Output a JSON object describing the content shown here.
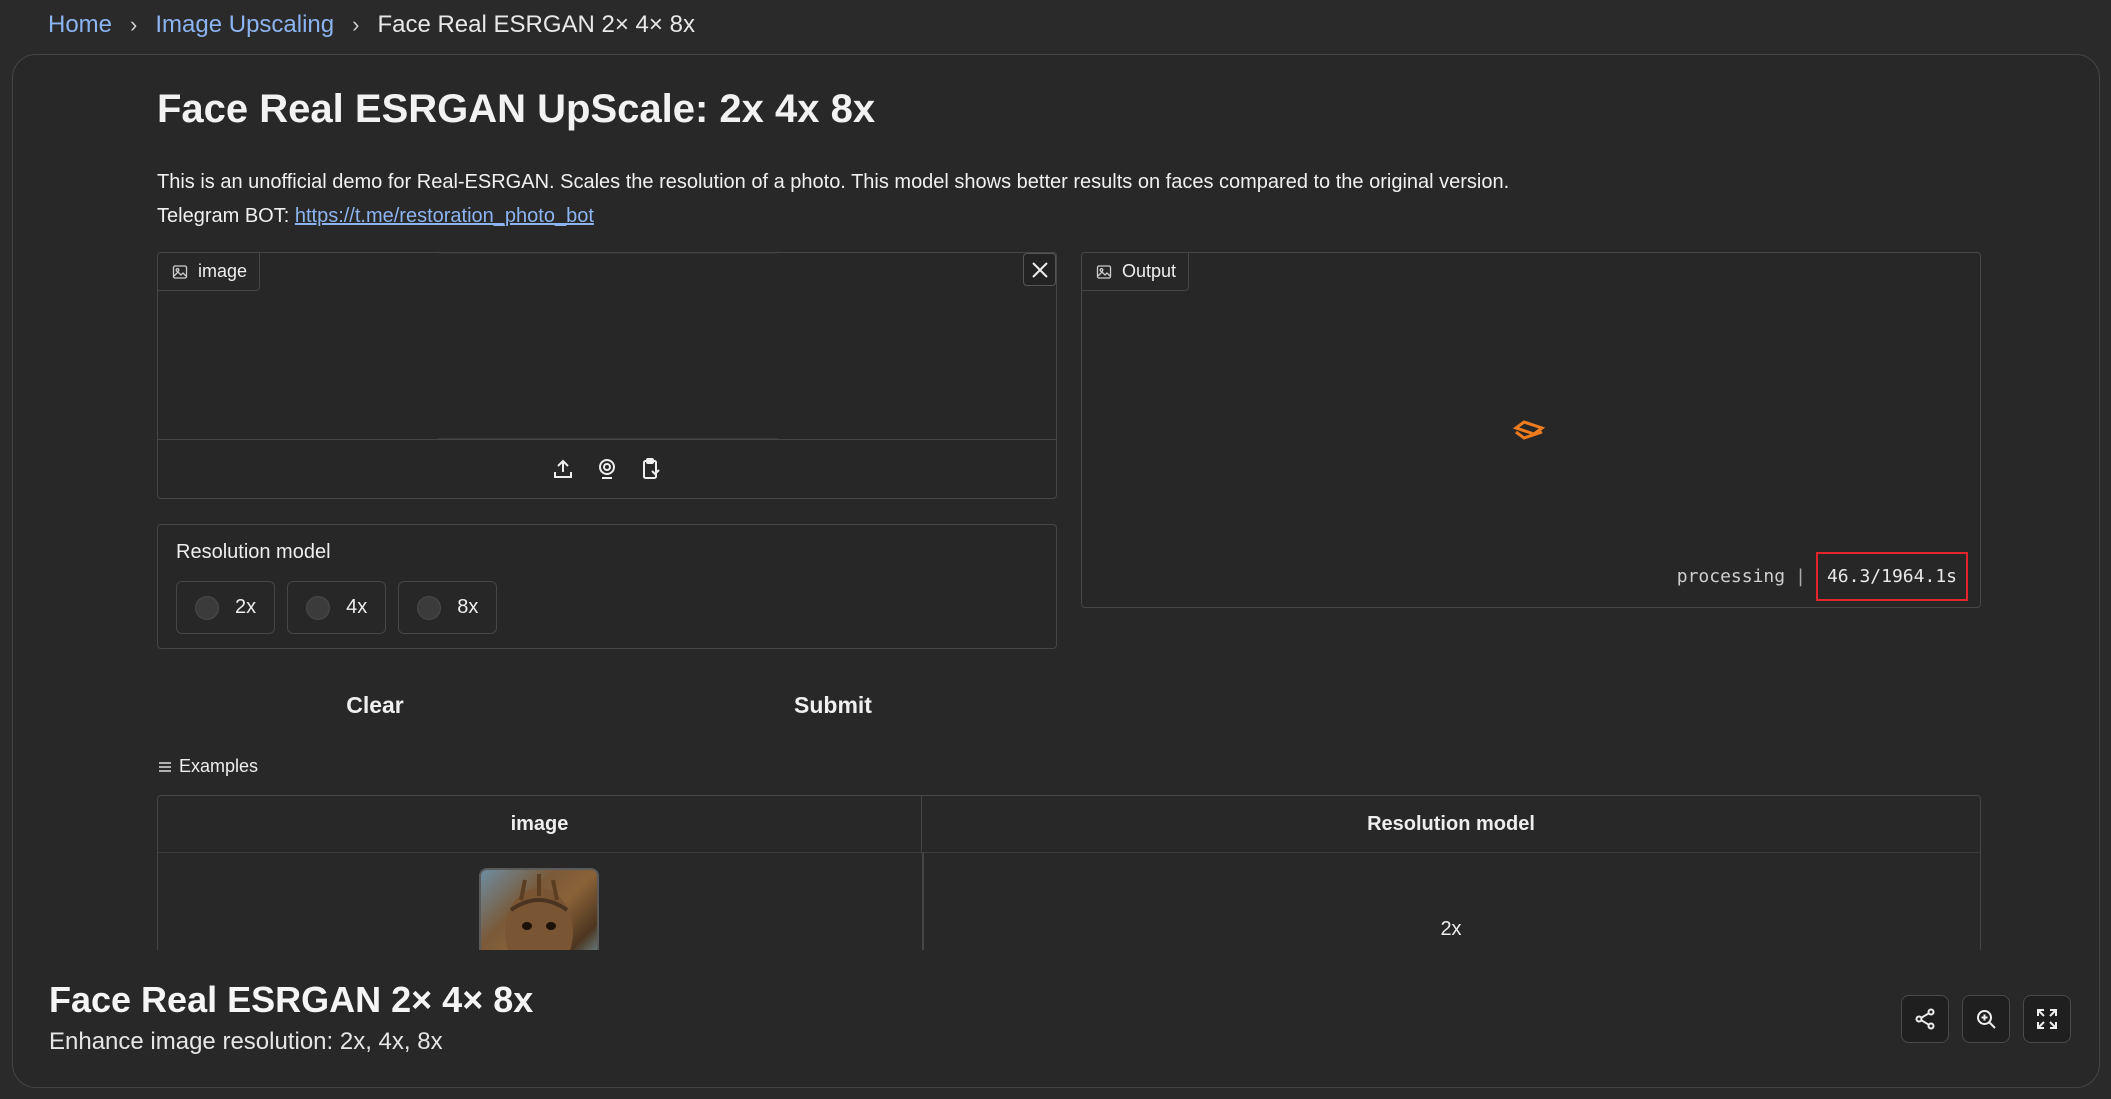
{
  "breadcrumb": {
    "home": "Home",
    "category": "Image Upscaling",
    "current": "Face Real ESRGAN 2× 4× 8x",
    "separator": "›"
  },
  "app": {
    "title": "Face Real ESRGAN UpScale: 2x 4x 8x",
    "description": "This is an unofficial demo for Real-ESRGAN. Scales the resolution of a photo. This model shows better results on faces compared to the original version.",
    "telegram_prefix": "Telegram BOT: ",
    "telegram_link": "https://t.me/restoration_photo_bot"
  },
  "input": {
    "label": "image",
    "icons": [
      "upload-icon",
      "webcam-icon",
      "clipboard-icon"
    ]
  },
  "resolution": {
    "label": "Resolution model",
    "options": [
      "2x",
      "4x",
      "8x"
    ]
  },
  "buttons": {
    "clear": "Clear",
    "submit": "Submit"
  },
  "output": {
    "label": "Output",
    "status": "processing",
    "separator": "|",
    "timer": "46.3/1964.1s"
  },
  "examples": {
    "label": "Examples",
    "columns": [
      "image",
      "Resolution model"
    ],
    "rows": [
      {
        "resolution": "2x"
      }
    ]
  },
  "footer": {
    "title": "Face Real ESRGAN 2× 4× 8x",
    "subtitle": "Enhance image resolution: 2x, 4x, 8x"
  },
  "colors": {
    "accent_link": "#8cb4f0",
    "highlight_box": "#e3242b",
    "spinner": "#f07b1e"
  }
}
